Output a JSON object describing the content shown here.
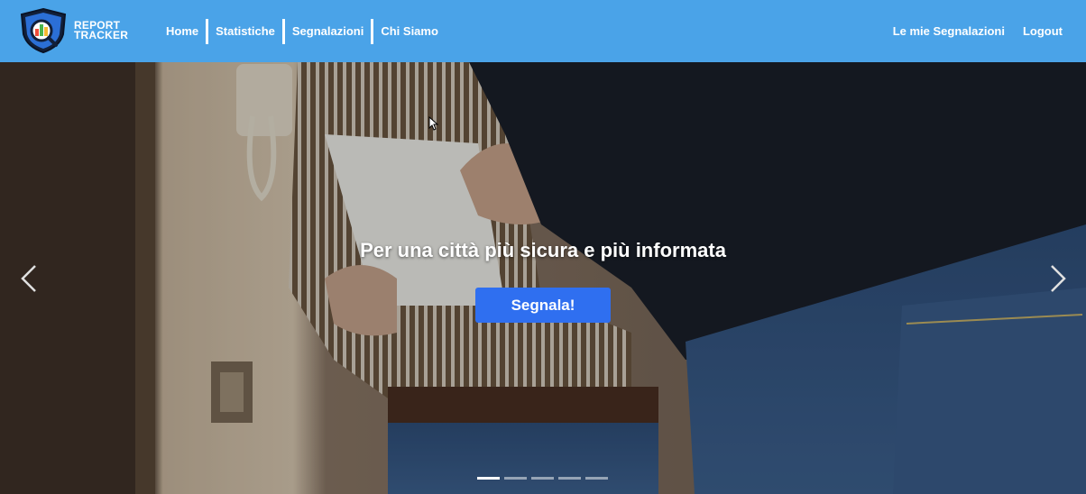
{
  "brand": {
    "line1": "REPORT",
    "line2": "TRACKER",
    "logo_icon": "shield-magnifier-chart-icon"
  },
  "nav": {
    "left": [
      {
        "label": "Home"
      },
      {
        "label": "Statistiche"
      },
      {
        "label": "Segnalazioni"
      },
      {
        "label": "Chi Siamo"
      }
    ],
    "right": [
      {
        "label": "Le mie Segnalazioni"
      },
      {
        "label": "Logout"
      }
    ]
  },
  "hero": {
    "title": "Per una città più sicura e più informata",
    "cta_label": "Segnala!",
    "prev_icon": "chevron-left-icon",
    "next_icon": "chevron-right-icon",
    "slides_count": 5,
    "active_slide": 1
  },
  "colors": {
    "navbar": "#4aa3e8",
    "cta": "#2f6ff0",
    "text": "#ffffff"
  }
}
